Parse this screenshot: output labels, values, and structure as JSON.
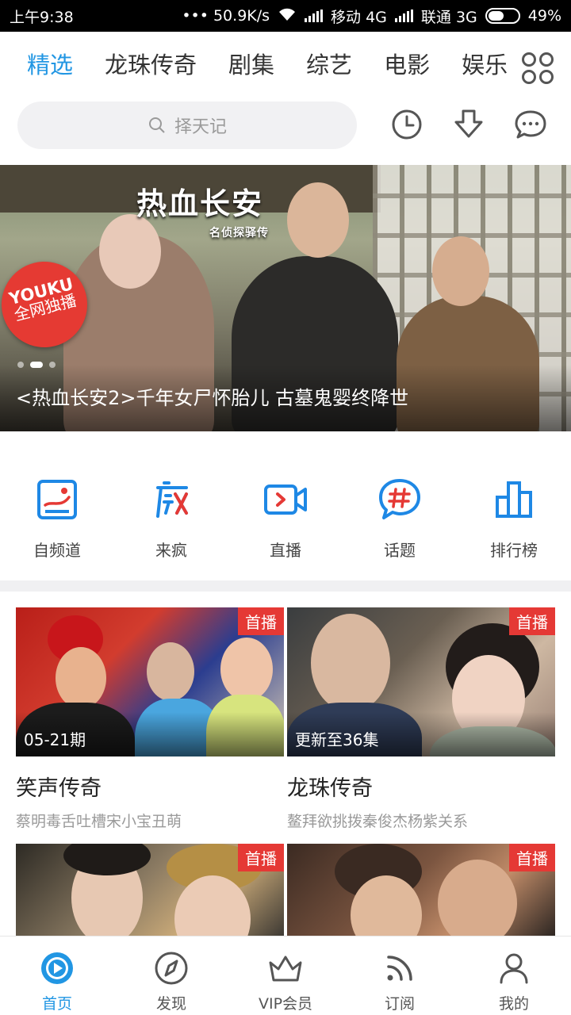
{
  "status_bar": {
    "time": "上午9:38",
    "speed": "••• 50.9K/s",
    "carrier1": "移动 4G",
    "carrier2": "联通 3G",
    "battery": "49%"
  },
  "tabs": [
    {
      "label": "精选",
      "active": true
    },
    {
      "label": "龙珠传奇"
    },
    {
      "label": "剧集"
    },
    {
      "label": "综艺"
    },
    {
      "label": "电影"
    },
    {
      "label": "娱乐"
    }
  ],
  "search": {
    "placeholder": "择天记"
  },
  "banner": {
    "art_title": "热血长安",
    "art_subtitle": "名侦探驿传",
    "badge_line1": "YOUKU",
    "badge_line2": "全网独播",
    "caption": "<热血长安2>千年女尸怀胎儿 古墓鬼婴终降世"
  },
  "quick_entries": [
    {
      "label": "自频道",
      "icon": "self-channel-icon"
    },
    {
      "label": "来疯",
      "icon": "laifeng-icon"
    },
    {
      "label": "直播",
      "icon": "live-camera-icon"
    },
    {
      "label": "话题",
      "icon": "topic-hash-icon"
    },
    {
      "label": "排行榜",
      "icon": "ranking-bars-icon"
    }
  ],
  "cards": [
    {
      "badge": "首播",
      "episode": "05-21期",
      "title": "笑声传奇",
      "subtitle": "蔡明毒舌吐槽宋小宝丑萌"
    },
    {
      "badge": "首播",
      "episode": "更新至36集",
      "title": "龙珠传奇",
      "subtitle": "鳌拜欲挑拨秦俊杰杨紫关系"
    },
    {
      "badge": "首播",
      "episode": "",
      "title": "",
      "subtitle": ""
    },
    {
      "badge": "首播",
      "episode": "",
      "title": "",
      "subtitle": ""
    }
  ],
  "bottom_nav": [
    {
      "label": "首页",
      "active": true,
      "icon": "home-play-icon"
    },
    {
      "label": "发现",
      "icon": "compass-icon"
    },
    {
      "label": "VIP会员",
      "icon": "crown-icon"
    },
    {
      "label": "订阅",
      "icon": "rss-icon"
    },
    {
      "label": "我的",
      "icon": "user-icon"
    }
  ],
  "colors": {
    "accent": "#2196e3",
    "badge_red": "#e53935"
  }
}
